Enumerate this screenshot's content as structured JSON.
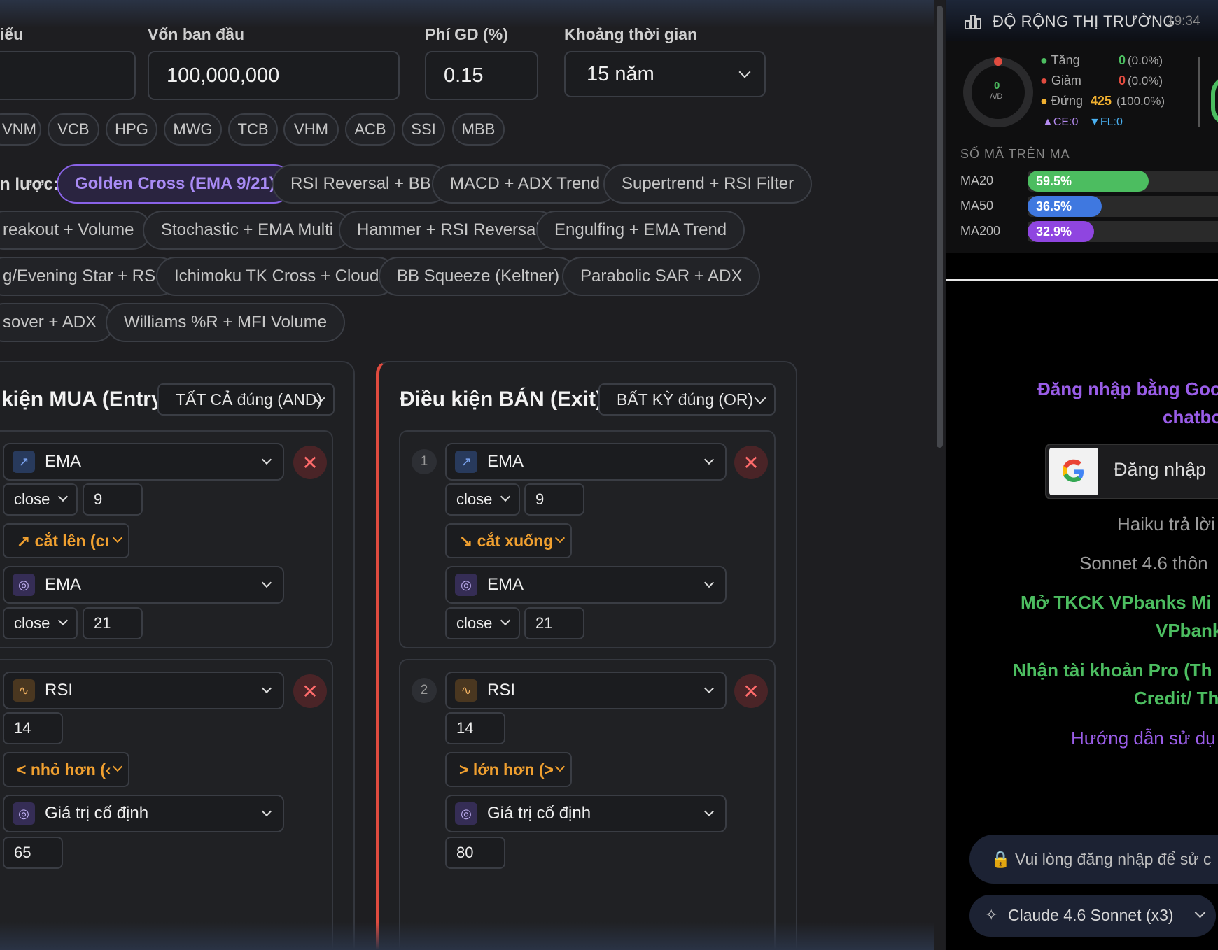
{
  "fields": {
    "symbol_label": "iếu",
    "capital_label": "Vốn ban đầu",
    "capital_value": "100,000,000",
    "fee_label": "Phí GD (%)",
    "fee_value": "0.15",
    "period_label": "Khoảng thời gian",
    "period_value": "15 năm"
  },
  "tickers": [
    "VNM",
    "VCB",
    "HPG",
    "MWG",
    "TCB",
    "VHM",
    "ACB",
    "SSI",
    "MBB"
  ],
  "strategy_label": "n lược:",
  "strategies": [
    "Golden Cross (EMA 9/21)",
    "RSI Reversal + BB",
    "MACD + ADX Trend",
    "Supertrend + RSI Filter",
    "reakout + Volume",
    "Stochastic + EMA Multi",
    "Hammer + RSI Reversal",
    "Engulfing + EMA Trend",
    "g/Evening Star + RSI",
    "Ichimoku TK Cross + Cloud",
    "BB Squeeze (Keltner)",
    "Parabolic SAR + ADX",
    "sover + ADX",
    "Williams %R + MFI Volume"
  ],
  "buy": {
    "title": "kiện MUA (Entry)",
    "logic": "TẤT CẢ đúng (AND)",
    "c1": {
      "ind1": "EMA",
      "src1": "close",
      "p1": "9",
      "op": "↗ cắt lên (cı",
      "ind2": "EMA",
      "src2": "close",
      "p2": "21"
    },
    "c2": {
      "ind1": "RSI",
      "p1": "14",
      "op": "< nhỏ hơn (‹",
      "ind2": "Giá trị cố định",
      "val": "65"
    }
  },
  "sell": {
    "title": "Điều kiện BÁN (Exit)",
    "logic": "BẤT KỲ đúng (OR)",
    "c1": {
      "num": "1",
      "ind1": "EMA",
      "src1": "close",
      "p1": "9",
      "op": "↘ cắt xuống",
      "ind2": "EMA",
      "src2": "close",
      "p2": "21"
    },
    "c2": {
      "num": "2",
      "ind1": "RSI",
      "p1": "14",
      "op": "> lớn hơn (>",
      "ind2": "Giá trị cố định",
      "val": "80"
    }
  },
  "breadth": {
    "title": "ĐỘ RỘNG THỊ TRƯỜNG",
    "time": "19:34",
    "ad_value": "0",
    "ad_label": "A/D",
    "up_label": "Tăng",
    "up_count": "0",
    "up_pct": "(0.0%)",
    "down_label": "Giảm",
    "down_count": "0",
    "down_pct": "(0.0%)",
    "flat_label": "Đứng",
    "flat_count": "425",
    "flat_pct": "(100.0%)",
    "ce": "▲CE:0",
    "fl": "▼FL:0",
    "ma_title": "SỐ MÃ TRÊN MA",
    "ma": [
      {
        "label": "MA20",
        "pct": 59.5,
        "text": "59.5%",
        "color": "#4cbd60"
      },
      {
        "label": "MA50",
        "pct": 36.5,
        "text": "36.5%",
        "color": "#3f78e0"
      },
      {
        "label": "MA200",
        "pct": 32.9,
        "text": "32.9%",
        "color": "#8f45e0"
      }
    ]
  },
  "login": {
    "line1": "Đăng nhập bằng Goo",
    "line2": "chatbo",
    "google_btn": "Đăng nhập",
    "info1": "Haiku trả lời",
    "info2": "Sonnet 4.6 thôn",
    "green1a": "Mở TKCK VPbanks Mi",
    "green1b": "VPbank",
    "green2a": "Nhận tài khoản Pro (Th",
    "green2b": "Credit/ Th",
    "guide": "Hướng dẫn sử dụ",
    "lock_msg": "🔒 Vui lòng đăng nhập để sử c",
    "model": "Claude 4.6 Sonnet (x3)"
  },
  "colors": {
    "accent": "#8a63e8",
    "danger": "#e04b3f",
    "warning": "#f0a030",
    "green": "#4cbd60"
  }
}
